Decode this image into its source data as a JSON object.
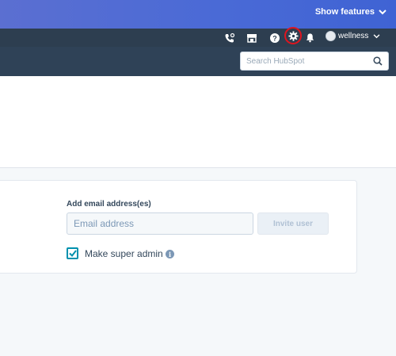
{
  "topbar": {
    "show_features_label": "Show features"
  },
  "navbar": {
    "icons": [
      "calling-icon",
      "marketplace-icon",
      "help-icon",
      "settings-gear-icon",
      "notifications-bell-icon"
    ],
    "account_name": "wellness",
    "highlight_color": "#e0141e"
  },
  "search": {
    "placeholder": "Search HubSpot"
  },
  "invite": {
    "field_label": "Add email address(es)",
    "email_placeholder": "Email address",
    "email_value": "",
    "invite_button_label": "Invite user",
    "super_admin_label": "Make super admin",
    "super_admin_checked": true,
    "info_glyph": "i"
  },
  "colors": {
    "nav_bg": "#2d3e50",
    "topbar_bg": "#4a6ad6",
    "accent": "#0091ae"
  }
}
